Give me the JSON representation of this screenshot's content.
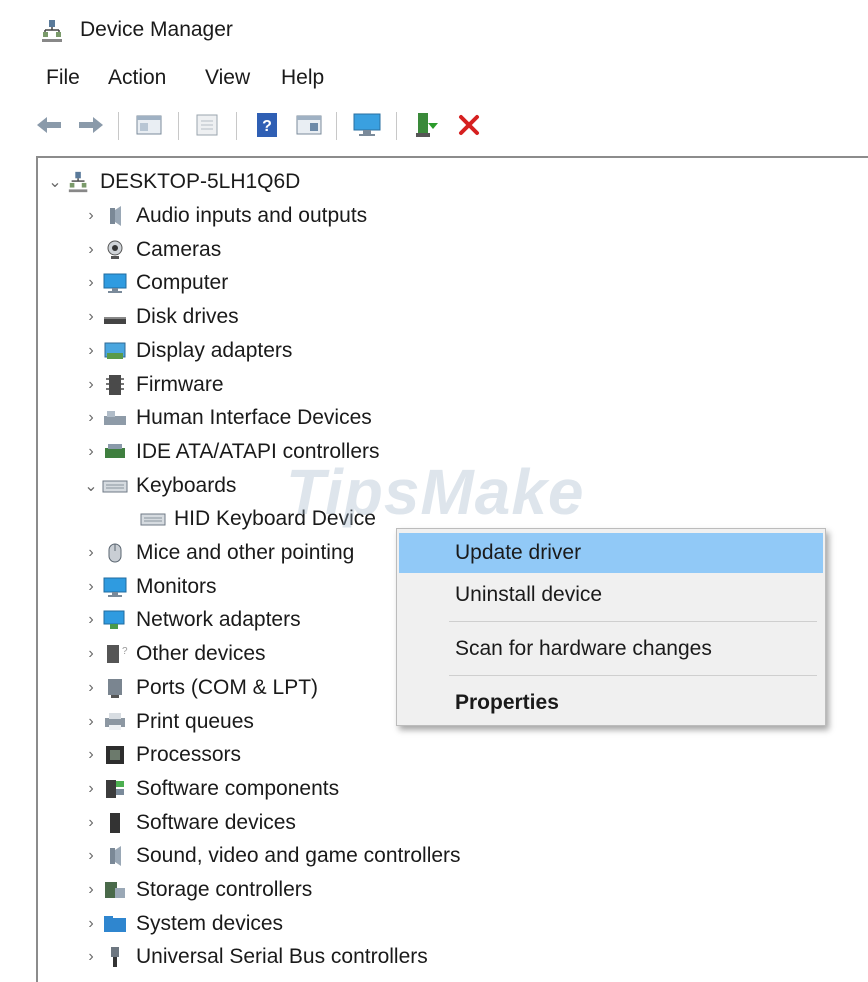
{
  "window": {
    "title": "Device Manager"
  },
  "menu": [
    "File",
    "Action",
    "View",
    "Help"
  ],
  "toolbar": {
    "buttons": [
      "back-arrow-icon",
      "forward-arrow-icon",
      "show-hide-tree-icon",
      "properties-icon",
      "help-icon",
      "view-details-icon",
      "scan-hardware-icon",
      "update-driver-icon",
      "uninstall-icon"
    ]
  },
  "tree": {
    "root": {
      "label": "DESKTOP-5LH1Q6D",
      "expanded": true
    },
    "items": [
      {
        "label": "Audio inputs and outputs",
        "icon": "speaker-icon",
        "expanded": false
      },
      {
        "label": "Cameras",
        "icon": "camera-icon",
        "expanded": false
      },
      {
        "label": "Computer",
        "icon": "monitor-icon",
        "expanded": false
      },
      {
        "label": "Disk drives",
        "icon": "disk-icon",
        "expanded": false
      },
      {
        "label": "Display adapters",
        "icon": "display-adapter-icon",
        "expanded": false
      },
      {
        "label": "Firmware",
        "icon": "firmware-icon",
        "expanded": false
      },
      {
        "label": "Human Interface Devices",
        "icon": "hid-icon",
        "expanded": false
      },
      {
        "label": "IDE ATA/ATAPI controllers",
        "icon": "ide-icon",
        "expanded": false
      },
      {
        "label": "Keyboards",
        "icon": "keyboard-icon",
        "expanded": true,
        "children": [
          {
            "label": "HID Keyboard Device",
            "icon": "keyboard-icon"
          }
        ]
      },
      {
        "label": "Mice and other pointing",
        "icon": "mouse-icon",
        "expanded": false
      },
      {
        "label": "Monitors",
        "icon": "monitor-icon",
        "expanded": false
      },
      {
        "label": "Network adapters",
        "icon": "network-icon",
        "expanded": false
      },
      {
        "label": "Other devices",
        "icon": "unknown-device-icon",
        "expanded": false
      },
      {
        "label": "Ports (COM & LPT)",
        "icon": "port-icon",
        "expanded": false
      },
      {
        "label": "Print queues",
        "icon": "printer-icon",
        "expanded": false
      },
      {
        "label": "Processors",
        "icon": "processor-icon",
        "expanded": false
      },
      {
        "label": "Software components",
        "icon": "software-component-icon",
        "expanded": false
      },
      {
        "label": "Software devices",
        "icon": "software-device-icon",
        "expanded": false
      },
      {
        "label": "Sound, video and game controllers",
        "icon": "speaker-icon",
        "expanded": false
      },
      {
        "label": "Storage controllers",
        "icon": "storage-icon",
        "expanded": false
      },
      {
        "label": "System devices",
        "icon": "system-folder-icon",
        "expanded": false
      },
      {
        "label": "Universal Serial Bus controllers",
        "icon": "usb-icon",
        "expanded": false
      }
    ]
  },
  "context_menu": {
    "items": [
      {
        "label": "Update driver",
        "highlighted": true,
        "bold": false
      },
      {
        "label": "Uninstall device",
        "highlighted": false,
        "bold": false
      },
      {
        "label": "Scan for hardware changes",
        "highlighted": false,
        "bold": false
      },
      {
        "label": "Properties",
        "highlighted": false,
        "bold": true
      }
    ]
  },
  "watermark": {
    "text": "TipsMake"
  },
  "colors": {
    "highlight": "#91c9f7",
    "uninstall_red": "#d62020",
    "chevron": "#6a6a6a"
  }
}
